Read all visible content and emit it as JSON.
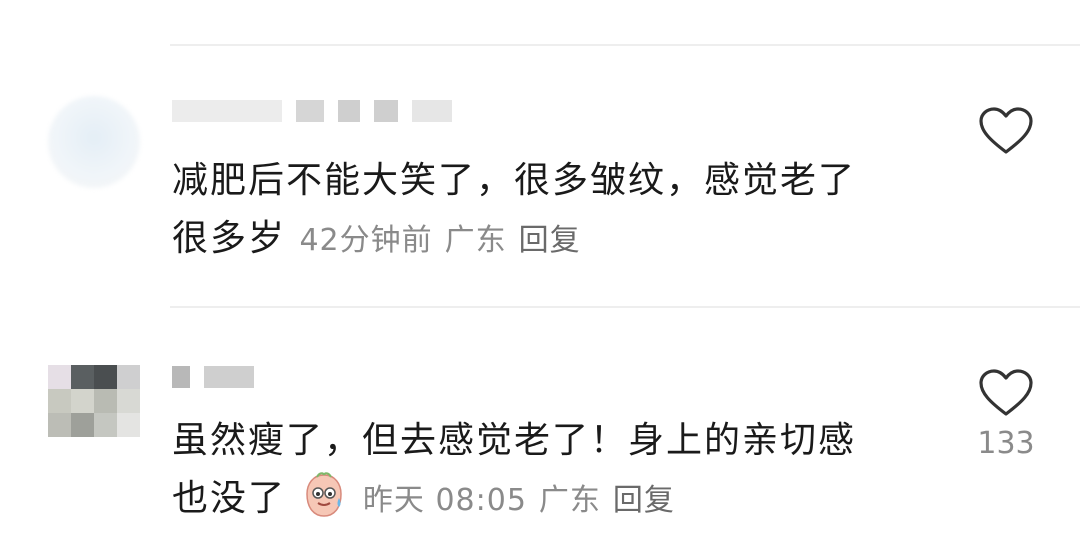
{
  "comments": [
    {
      "text_line1": "减肥后不能大笑了，很多皱纹，感觉老了",
      "text_line2": "很多岁",
      "time": "42分钟前",
      "location": "广东",
      "reply_label": "回复",
      "like_count": ""
    },
    {
      "text_line1": "虽然瘦了，但去感觉老了！身上的亲切感",
      "text_line2": "也没了",
      "emoji": "sweat-smile-emoji",
      "time": "昨天 08:05",
      "location": "广东",
      "reply_label": "回复",
      "like_count": "133"
    }
  ],
  "icons": {
    "like": "heart-outline-icon"
  },
  "colors": {
    "text": "#1a1a1a",
    "meta": "#8a8a8a",
    "divider": "#eeeeee"
  }
}
